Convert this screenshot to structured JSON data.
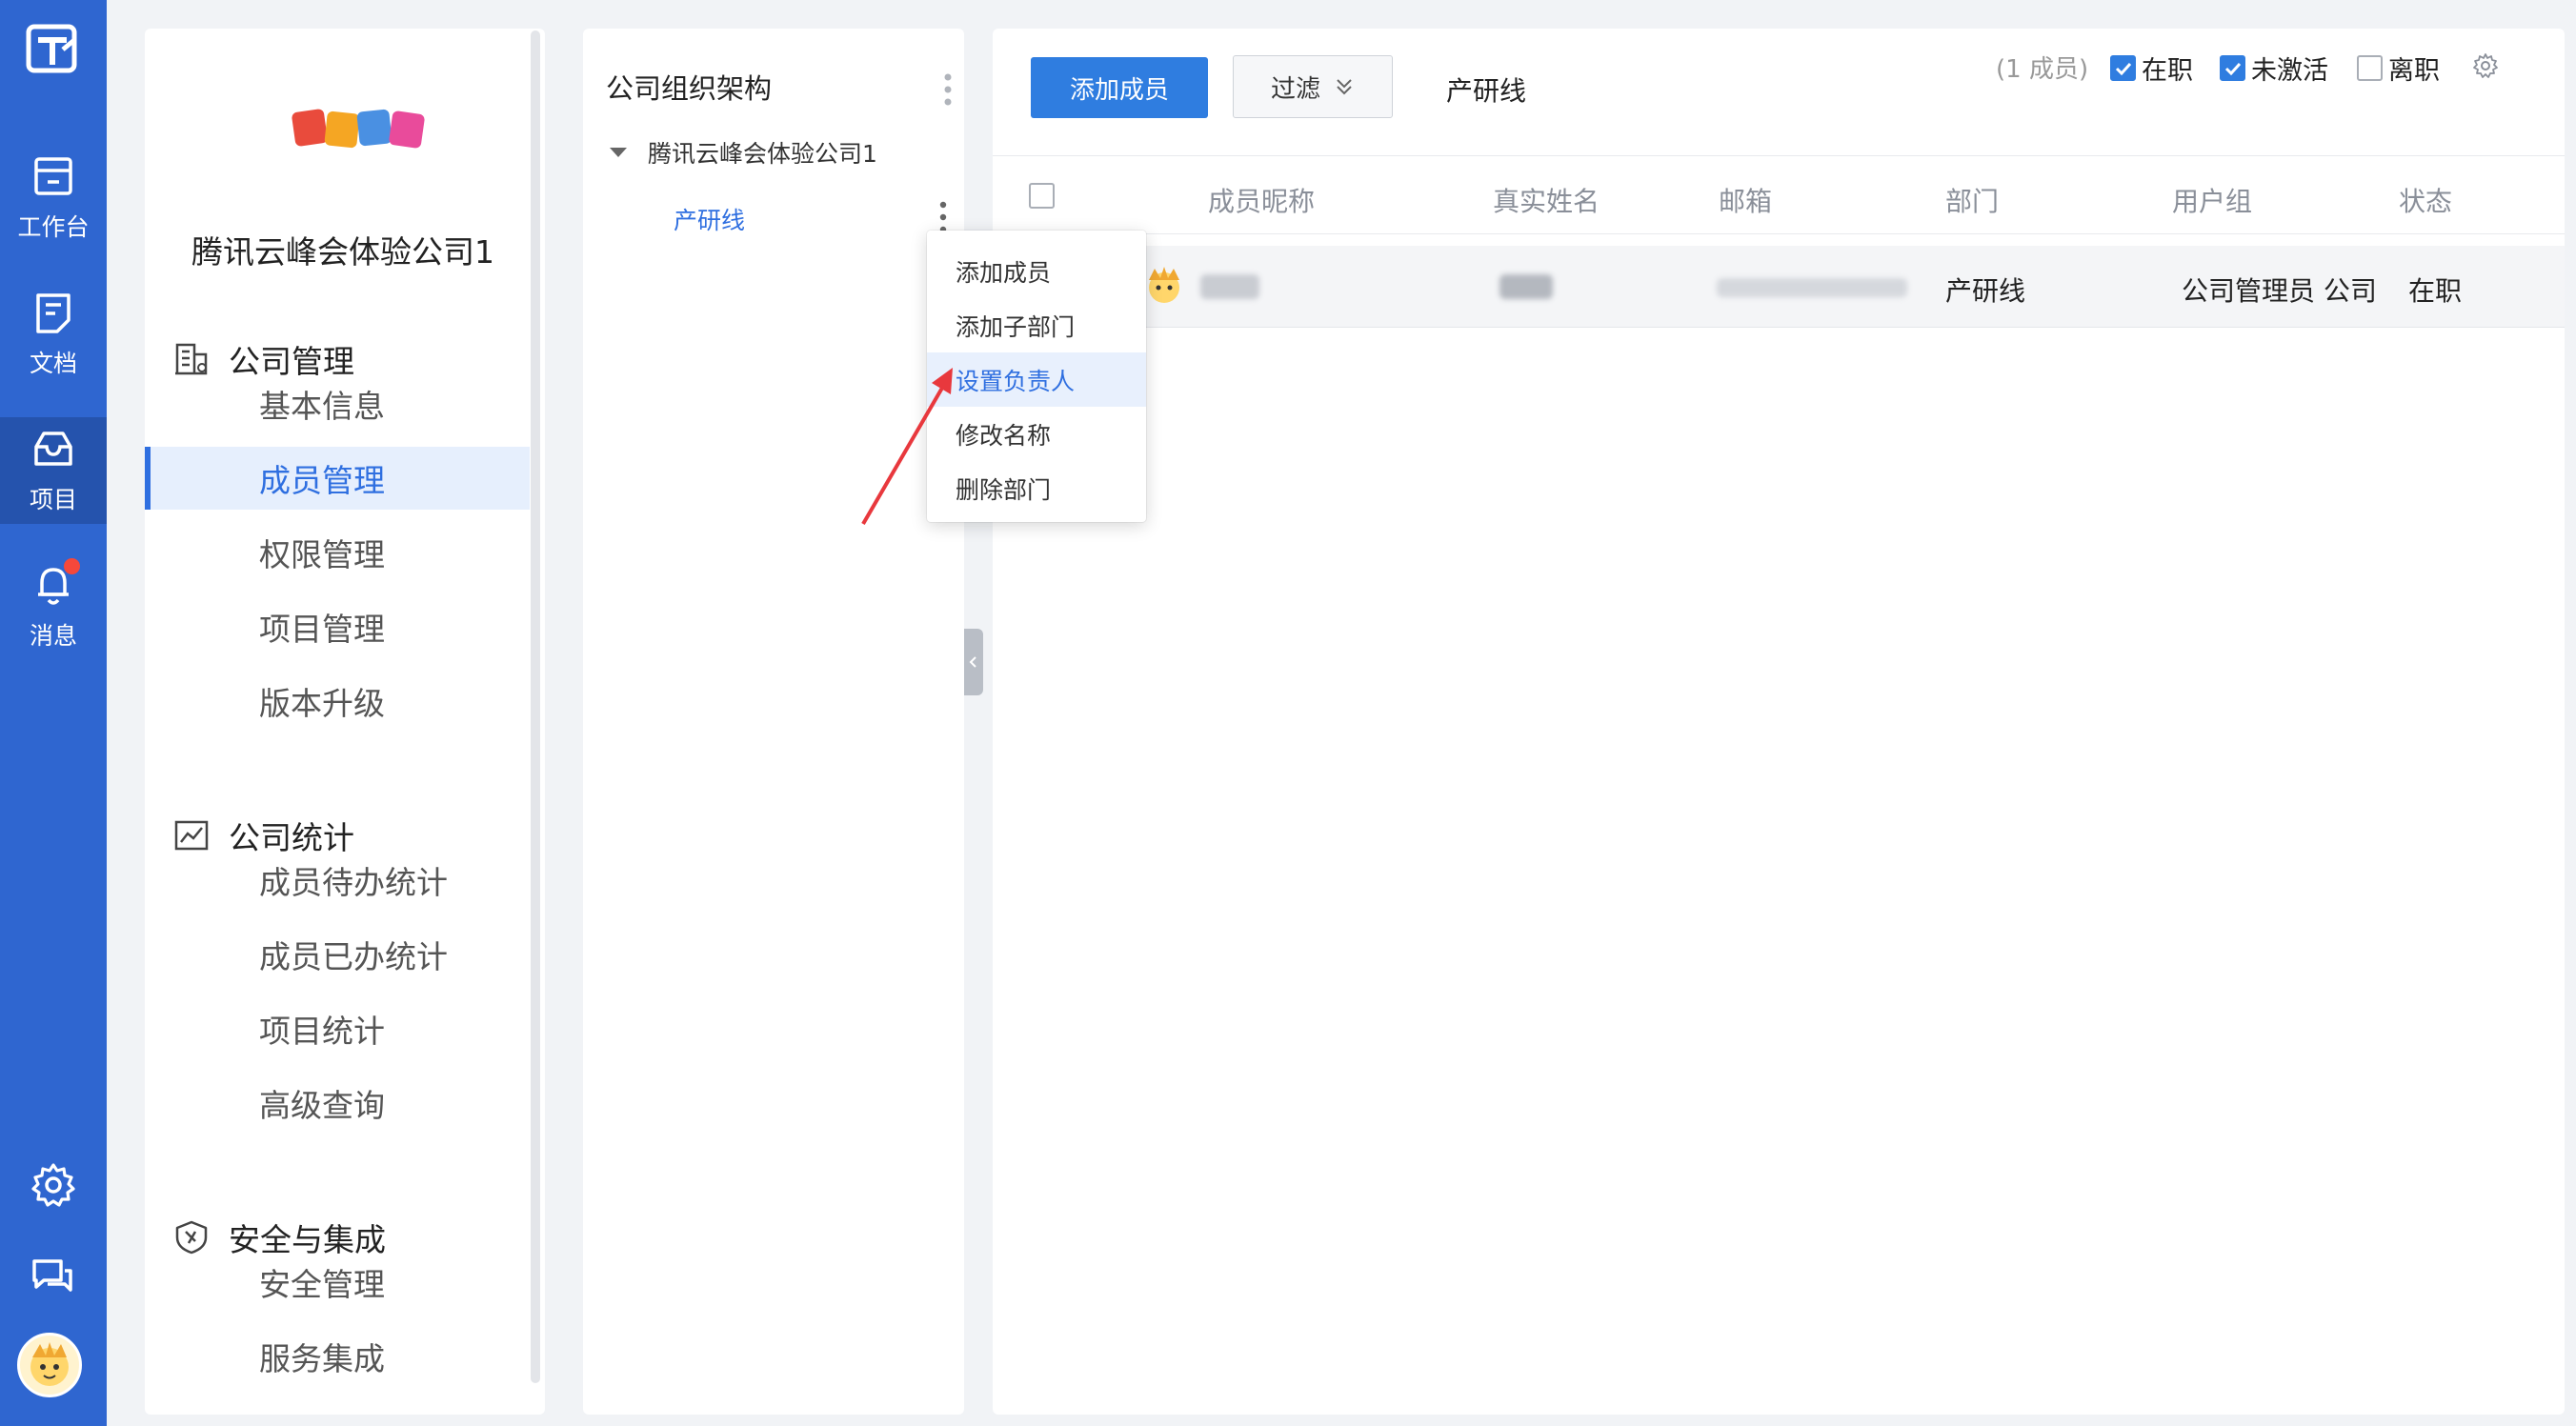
{
  "rail": {
    "items": [
      {
        "label": "工作台",
        "icon": "workbench-icon"
      },
      {
        "label": "文档",
        "icon": "document-icon"
      },
      {
        "label": "项目",
        "icon": "project-inbox-icon",
        "active": true
      },
      {
        "label": "消息",
        "icon": "bell-icon",
        "badge": true
      }
    ],
    "bottom_icons": [
      "settings-gear-icon",
      "chat-bubbles-icon",
      "user-avatar"
    ],
    "color": "#2f66d0"
  },
  "sidebar": {
    "company_name": "腾讯云峰会体验公司1",
    "groups": [
      {
        "title": "公司管理",
        "icon": "company-building-icon",
        "items": [
          "基本信息",
          "成员管理",
          "权限管理",
          "项目管理",
          "版本升级"
        ]
      },
      {
        "title": "公司统计",
        "icon": "line-chart-icon",
        "items": [
          "成员待办统计",
          "成员已办统计",
          "项目统计",
          "高级查询"
        ]
      },
      {
        "title": "安全与集成",
        "icon": "shield-icon",
        "items": [
          "安全管理",
          "服务集成"
        ]
      }
    ],
    "active_item": "成员管理"
  },
  "org": {
    "title": "公司组织架构",
    "root": "腾讯云峰会体验公司1",
    "child": "产研线"
  },
  "context_menu": {
    "items": [
      "添加成员",
      "添加子部门",
      "设置负责人",
      "修改名称",
      "删除部门"
    ],
    "hovered": "设置负责人"
  },
  "toolbar": {
    "add_member": "添加成员",
    "filter": "过滤",
    "current_dept": "产研线",
    "member_count": "(1 成员)",
    "filters": [
      {
        "label": "在职",
        "checked": true
      },
      {
        "label": "未激活",
        "checked": true
      },
      {
        "label": "离职",
        "checked": false
      }
    ]
  },
  "table": {
    "columns": [
      "成员昵称",
      "真实姓名",
      "邮箱",
      "部门",
      "用户组",
      "状态"
    ],
    "rows": [
      {
        "department": "产研线",
        "user_group": "公司管理员 公司",
        "status": "在职"
      }
    ]
  },
  "colors": {
    "accent": "#2f7de0",
    "active_text": "#2f6fe0",
    "badge": "#f5483b",
    "arrow": "#e8383d"
  }
}
